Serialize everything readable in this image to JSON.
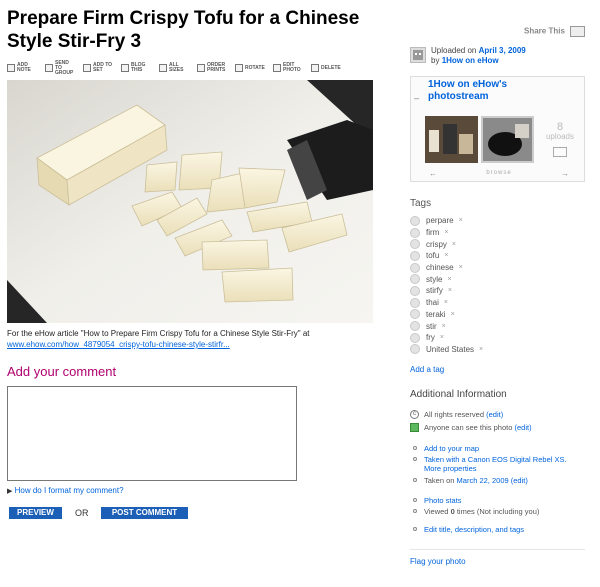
{
  "page": {
    "title": "Prepare Firm Crispy Tofu for a Chinese Style Stir-Fry 3",
    "share_label": "Share This"
  },
  "toolbar": {
    "items": [
      {
        "icon": "add-note-icon",
        "label": "ADD NOTE"
      },
      {
        "icon": "send-to-group-icon",
        "label": "SEND TO GROUP"
      },
      {
        "icon": "add-to-set-icon",
        "label": "ADD TO SET"
      },
      {
        "icon": "blog-this-icon",
        "label": "BLOG THIS"
      },
      {
        "icon": "all-sizes-icon",
        "label": "ALL SIZES"
      },
      {
        "icon": "order-prints-icon",
        "label": "ORDER PRINTS"
      },
      {
        "icon": "rotate-icon",
        "label": "ROTATE"
      },
      {
        "icon": "edit-photo-icon",
        "label": "EDIT PHOTO"
      },
      {
        "icon": "delete-icon",
        "label": "DELETE"
      }
    ]
  },
  "photo": {
    "caption_text": "For the eHow article \"How to Prepare Firm Crispy Tofu for a Chinese Style Stir-Fry\" at",
    "caption_link": "www.ehow.com/how_4879054_crispy-tofu-chinese-style-stirfr..."
  },
  "comment": {
    "heading": "Add your comment",
    "format_link": "How do I format my comment?",
    "preview_label": "PREVIEW",
    "or_label": "OR",
    "post_label": "POST COMMENT"
  },
  "sidebar": {
    "uploaded_prefix": "Uploaded on",
    "uploaded_date": "April 3, 2009",
    "by_prefix": "by",
    "uploader": "1How on eHow",
    "stream_toggle": "–",
    "stream_title_line1": "1How on eHow's",
    "stream_title_line2": "photostream",
    "uploads_count": "8",
    "uploads_label": "uploads",
    "browse_label": "browse",
    "prev_arrow": "←",
    "next_arrow": "→",
    "tags_heading": "Tags",
    "tags": [
      "perpare",
      "firm",
      "crispy",
      "tofu",
      "chinese",
      "style",
      "stirfy",
      "thai",
      "teraki",
      "stir",
      "fry",
      "United States"
    ],
    "tag_remove": "×",
    "add_tag": "Add a tag",
    "info_heading": "Additional Information",
    "rights": "All rights reserved",
    "rights_edit": "(edit)",
    "visibility": "Anyone can see this photo",
    "visibility_edit": "(edit)",
    "add_to_map": "Add to your map",
    "taken_with": "Taken with a Canon EOS Digital Rebel XS.",
    "more_properties": "More properties",
    "taken_on_prefix": "Taken on",
    "taken_on_date": "March 22, 2009",
    "taken_on_edit": "(edit)",
    "photo_stats": "Photo stats",
    "viewed_prefix": "Viewed",
    "viewed_count": "0",
    "viewed_suffix": "times  (Not including you)",
    "edit_meta": "Edit title, description, and tags",
    "flag_photo": "Flag your photo"
  }
}
